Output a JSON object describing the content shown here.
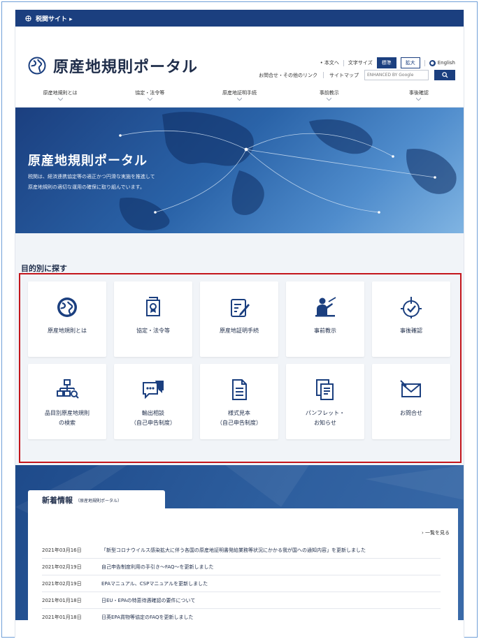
{
  "topbar": {
    "label": "税関サイト ▸"
  },
  "brand": {
    "title": "原産地規則ポータル"
  },
  "utility": {
    "skip_link": "• 本文へ",
    "text_size_label": "文字サイズ",
    "size_standard": "標準",
    "size_large": "拡大",
    "english": "English",
    "contact_link": "お問合せ・その他のリンク",
    "sitemap": "サイトマップ",
    "search_placeholder": "ENHANCED BY Google"
  },
  "gnav": {
    "items": [
      {
        "label": "原産地規則とは"
      },
      {
        "label": "協定・法令等"
      },
      {
        "label": "原産地証明手続"
      },
      {
        "label": "事前教示"
      },
      {
        "label": "事後確認"
      }
    ]
  },
  "hero": {
    "title": "原産地規則ポータル",
    "desc_line1": "税関は、経済連携協定等の適正かつ円滑な実施を推進して",
    "desc_line2": "原産地規則の適切な運用の確保に取り組んでいます。"
  },
  "purpose": {
    "heading": "目的別に探す",
    "cards": [
      {
        "line1": "原産地規則とは",
        "line2": ""
      },
      {
        "line1": "協定・法令等",
        "line2": ""
      },
      {
        "line1": "原産地証明手続",
        "line2": ""
      },
      {
        "line1": "事前教示",
        "line2": ""
      },
      {
        "line1": "事後確認",
        "line2": ""
      },
      {
        "line1": "品目別原産地規則",
        "line2": "の検索"
      },
      {
        "line1": "輸出相談",
        "line2": "（自己申告制度）"
      },
      {
        "line1": "様式見本",
        "line2": "（自己申告制度）"
      },
      {
        "line1": "パンフレット・",
        "line2": "お知らせ"
      },
      {
        "line1": "お問合せ",
        "line2": ""
      }
    ]
  },
  "news": {
    "title": "新着情報",
    "subtitle": "（原産地規則ポータル）",
    "more": "› 一覧を見る",
    "items": [
      {
        "date": "2021年03月16日",
        "text": "「新型コロナウイルス感染拡大に伴う各国の原産地証明書発給業務等状況にかかる我が国への通知内容」を更新しました"
      },
      {
        "date": "2021年02月19日",
        "text": "自己申告制度利用の手引き～FAQ～を更新しました"
      },
      {
        "date": "2021年02月19日",
        "text": "EPAマニュアル、CSPマニュアルを更新しました"
      },
      {
        "date": "2021年01月18日",
        "text": "日EU・EPAの特恵待遇確認の要件について"
      },
      {
        "date": "2021年01月18日",
        "text": "日英EPA貨物等協定のFAQを更新しました"
      }
    ]
  },
  "colors": {
    "navy": "#1b3f7f",
    "highlight": "#c4161c",
    "panel": "#f1f4f8"
  }
}
